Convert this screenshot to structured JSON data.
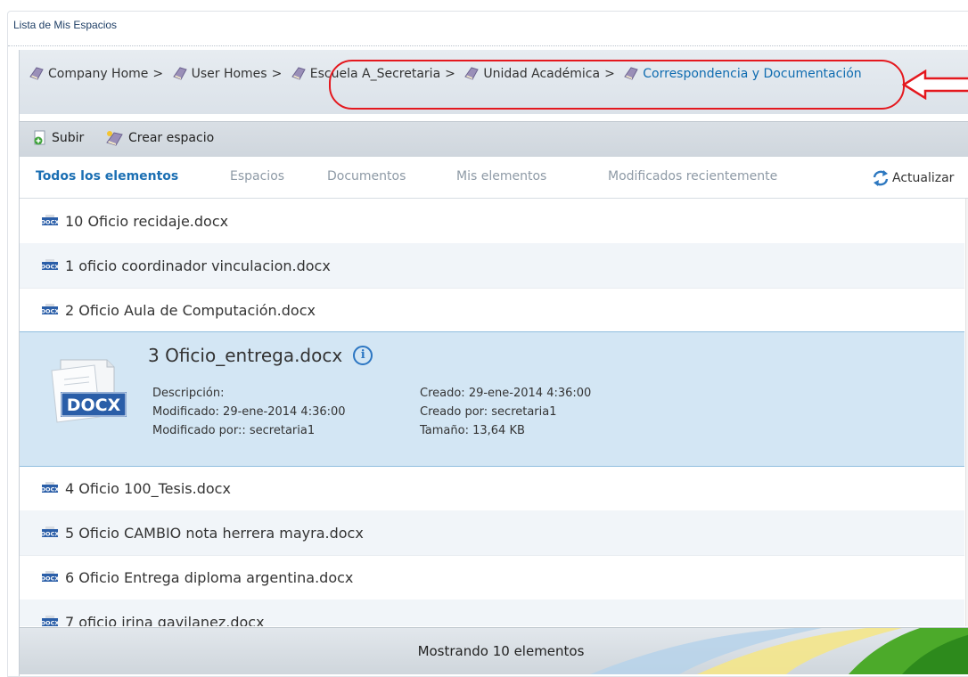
{
  "panel": {
    "title": "Lista de Mis Espacios"
  },
  "breadcrumb": {
    "items": [
      {
        "label": "Company Home",
        "current": false
      },
      {
        "label": "User Homes",
        "current": false
      },
      {
        "label": "Escuela A_Secretaria",
        "current": false
      },
      {
        "label": "Unidad Académica",
        "current": false
      },
      {
        "label": "Correspondencia y Documentación",
        "current": true
      }
    ],
    "separator": ">"
  },
  "toolbar": {
    "upload_label": "Subir",
    "create_space_label": "Crear espacio"
  },
  "filters": {
    "all": "Todos los elementos",
    "spaces": "Espacios",
    "documents": "Documentos",
    "my_items": "Mis elementos",
    "recent": "Modificados recientemente",
    "refresh": "Actualizar"
  },
  "files": [
    {
      "name": "10 Oficio recidaje.docx"
    },
    {
      "name": "1 oficio coordinador vinculacion.docx"
    },
    {
      "name": "2 Oficio Aula de Computación.docx"
    },
    {
      "name": "3 Oficio_entrega.docx",
      "expanded": true,
      "description_label": "Descripción:",
      "modified_label": "Modificado: 29-ene-2014 4:36:00",
      "modified_by_label": "Modificado por:: secretaria1",
      "created_label": "Creado: 29-ene-2014 4:36:00",
      "created_by_label": "Creado por: secretaria1",
      "size_label": "Tamaño: 13,64 KB"
    },
    {
      "name": "4 Oficio 100_Tesis.docx"
    },
    {
      "name": "5 Oficio CAMBIO nota herrera mayra.docx"
    },
    {
      "name": "6 Oficio Entrega diploma argentina.docx"
    },
    {
      "name": "7 oficio irina gavilanez.docx"
    }
  ],
  "footer": {
    "status": "Mostrando 10 elementos"
  },
  "icons": {
    "space": "book-icon",
    "file": "docx-icon",
    "upload": "upload-icon",
    "create": "create-space-icon",
    "refresh": "refresh-icon",
    "info": "info-icon"
  },
  "colors": {
    "link": "#0f6cb0",
    "selected_row": "#d3e6f4",
    "highlight": "#e4181e",
    "active_filter": "#1b6fb3"
  }
}
